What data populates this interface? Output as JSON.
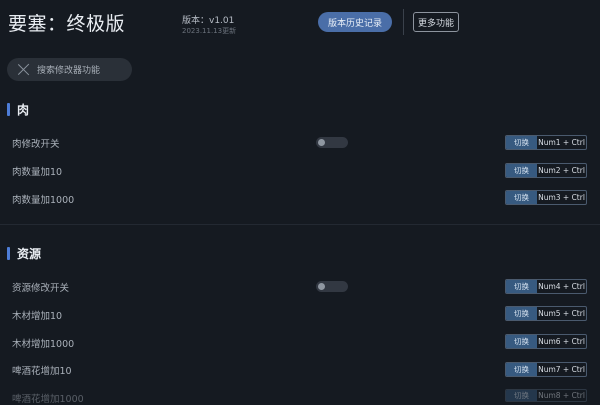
{
  "header": {
    "title": "要塞：终极版",
    "version": "版本：v1.01",
    "date": "2023.11.13更新",
    "history_button": "版本历史记录",
    "more_button": "更多功能"
  },
  "search": {
    "placeholder": "搜索修改器功能"
  },
  "sections": [
    {
      "title": "肉",
      "rows": [
        {
          "label": "肉修改开关",
          "toggle": true,
          "toggle_on": false,
          "switch_label": "切换",
          "hotkey": "Num1 + Ctrl"
        },
        {
          "label": "肉数量加10",
          "toggle": false,
          "switch_label": "切换",
          "hotkey": "Num2 + Ctrl"
        },
        {
          "label": "肉数量加1000",
          "toggle": false,
          "switch_label": "切换",
          "hotkey": "Num3 + Ctrl"
        }
      ]
    },
    {
      "title": "资源",
      "rows": [
        {
          "label": "资源修改开关",
          "toggle": true,
          "toggle_on": false,
          "switch_label": "切换",
          "hotkey": "Num4 + Ctrl"
        },
        {
          "label": "木材增加10",
          "toggle": false,
          "switch_label": "切换",
          "hotkey": "Num5 + Ctrl"
        },
        {
          "label": "木材增加1000",
          "toggle": false,
          "switch_label": "切换",
          "hotkey": "Num6 + Ctrl"
        },
        {
          "label": "啤酒花增加10",
          "toggle": false,
          "switch_label": "切换",
          "hotkey": "Num7 + Ctrl"
        },
        {
          "label": "啤酒花增加1000",
          "toggle": false,
          "switch_label": "切换",
          "hotkey": "Num8 + Ctrl"
        }
      ]
    }
  ],
  "colors": {
    "background": "#151a21",
    "accent": "#4d7dd8",
    "primary_button": "#4a6ea8",
    "switch_chip": "#375a80"
  }
}
